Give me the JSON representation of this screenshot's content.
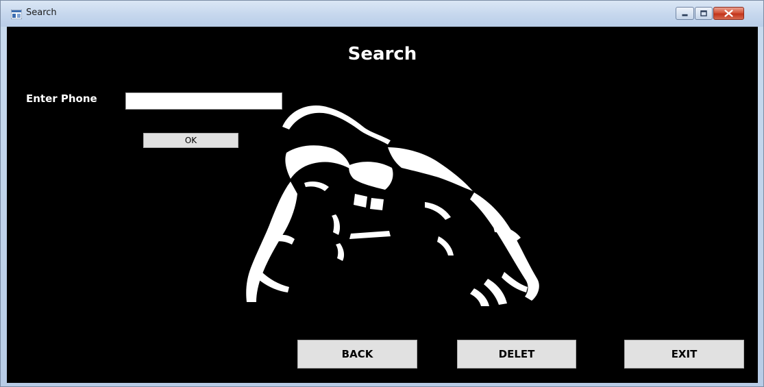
{
  "window": {
    "title": "Search",
    "icon": "form-window-icon",
    "controls": [
      "minimize-icon",
      "maximize-icon",
      "close-icon"
    ]
  },
  "form": {
    "heading": "Search",
    "phone_label": "Enter Phone",
    "phone_value": "",
    "ok_label": "OK",
    "image": "bodybuilder-silhouette"
  },
  "actions": {
    "back_label": "BACK",
    "delete_label": "DELET",
    "exit_label": "EXIT"
  },
  "colors": {
    "form_background": "#000000",
    "text": "#ffffff",
    "button_face": "#e1e1e1",
    "close_button": "#c7432a"
  }
}
